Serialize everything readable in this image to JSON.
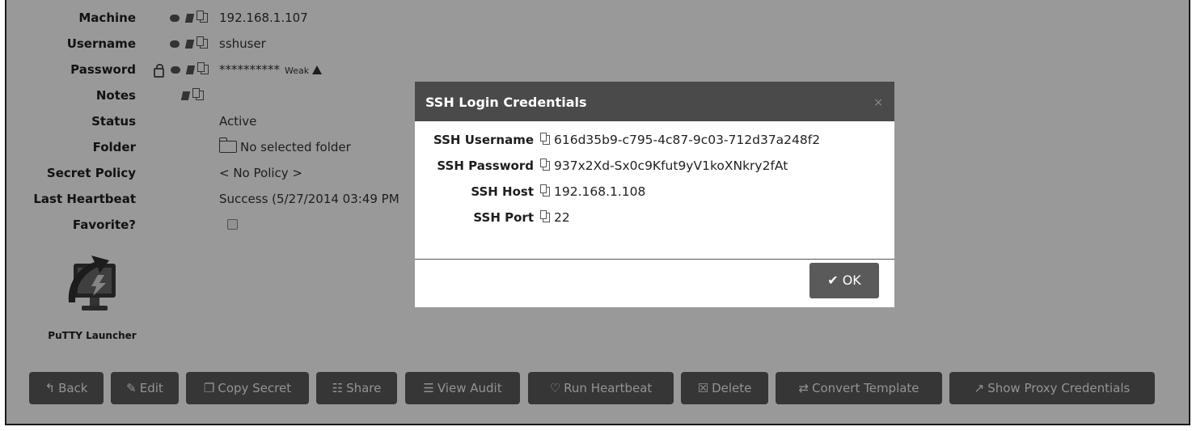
{
  "details": {
    "rows": [
      {
        "label": "Machine",
        "value": "192.168.1.107"
      },
      {
        "label": "Username",
        "value": "sshuser"
      },
      {
        "label": "Password",
        "value": "**********",
        "strength": "Weak"
      },
      {
        "label": "Notes",
        "value": ""
      },
      {
        "label": "Status",
        "value": "Active"
      },
      {
        "label": "Folder",
        "value": "No selected folder"
      },
      {
        "label": "Secret Policy",
        "value": "< No Policy >"
      },
      {
        "label": "Last Heartbeat",
        "value": "Success (5/27/2014 03:49 PM"
      },
      {
        "label": "Favorite?",
        "value": ""
      }
    ]
  },
  "launcher": {
    "label": "PuTTY Launcher",
    "icon": "putty-icon"
  },
  "toolbar": {
    "buttons": [
      {
        "label": "Back",
        "icon": "back-arrow-icon"
      },
      {
        "label": "Edit",
        "icon": "pencil-icon"
      },
      {
        "label": "Copy Secret",
        "icon": "copy-icon"
      },
      {
        "label": "Share",
        "icon": "users-icon"
      },
      {
        "label": "View Audit",
        "icon": "list-icon"
      },
      {
        "label": "Run Heartbeat",
        "icon": "heart-icon"
      },
      {
        "label": "Delete",
        "icon": "trash-icon"
      },
      {
        "label": "Convert Template",
        "icon": "exchange-icon"
      },
      {
        "label": "Show Proxy Credentials",
        "icon": "external-link-icon"
      }
    ]
  },
  "modal": {
    "title": "SSH Login Credentials",
    "close": "×",
    "rows": [
      {
        "label": "SSH Username",
        "value": "616d35b9-c795-4c87-9c03-712d37a248f2"
      },
      {
        "label": "SSH Password",
        "value": "937x2Xd-Sx0c9Kfut9yV1koXNkry2fAt"
      },
      {
        "label": "SSH Host",
        "value": "192.168.1.108"
      },
      {
        "label": "SSH Port",
        "value": "22"
      }
    ],
    "ok_label": "OK"
  },
  "colors": {
    "button_bg": "#5a5a5a",
    "modal_header": "#4a4a4a",
    "overlay": "rgba(0,0,0,0.40)"
  }
}
